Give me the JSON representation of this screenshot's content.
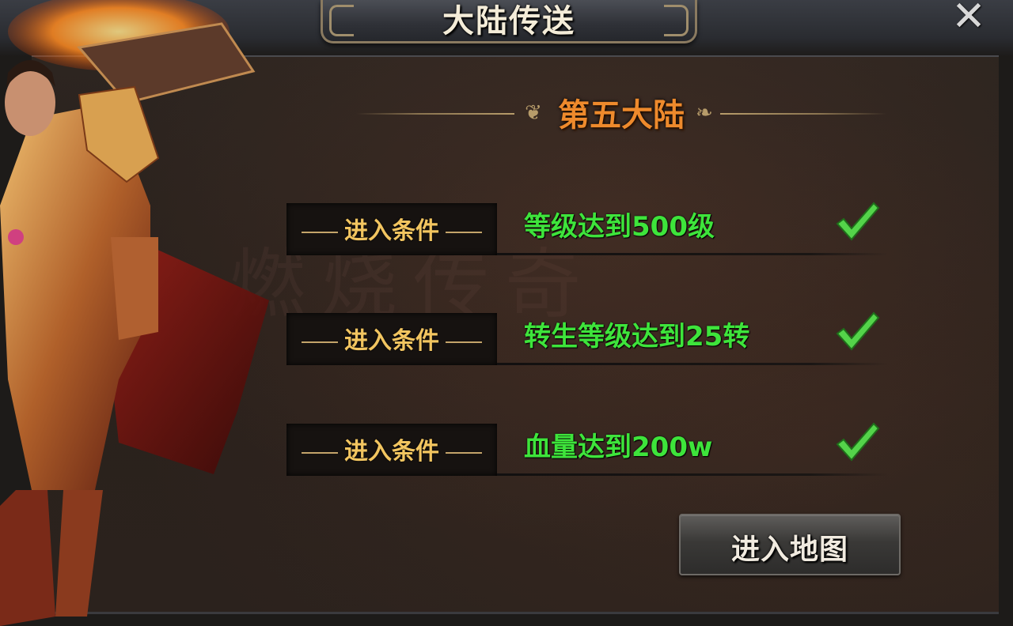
{
  "dialog": {
    "title": "大陆传送",
    "close_symbol": "✕",
    "continent_name": "第五大陆",
    "watermark": "燃烧传奇"
  },
  "conditions": [
    {
      "label": "进入条件",
      "requirement": "等级达到500级",
      "met": true,
      "icon": "check-icon"
    },
    {
      "label": "进入条件",
      "requirement": "转生等级达到25转",
      "met": true,
      "icon": "check-icon"
    },
    {
      "label": "进入条件",
      "requirement": "血量达到200w",
      "met": true,
      "icon": "check-icon"
    }
  ],
  "actions": {
    "enter_map_label": "进入地图"
  },
  "colors": {
    "requirement_text": "#3ee43b",
    "continent_title": "#ee8a2c",
    "condition_label": "#f2c560",
    "check": "#54d44a"
  }
}
